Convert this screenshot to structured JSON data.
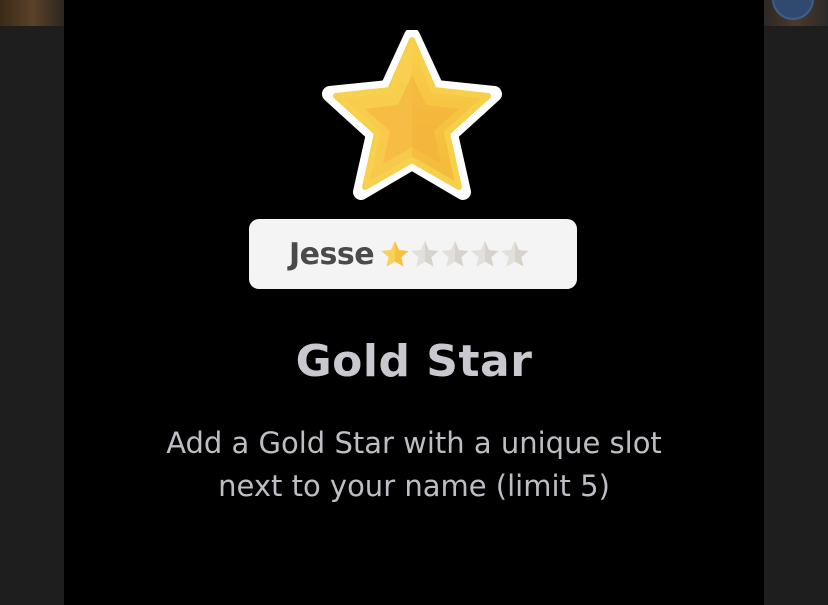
{
  "modal": {
    "title": "Gold Star",
    "description": "Add a Gold Star with a unique slot next to your name (limit 5)",
    "hero_icon": "gold-star-icon"
  },
  "badge": {
    "name": "Jesse",
    "stars_filled": 1,
    "stars_total": 5
  },
  "colors": {
    "gold": "#f6c13b",
    "gold_dark": "#f0a830",
    "star_empty": "#d8d6cf",
    "modal_bg": "#000000",
    "title_text": "#c8c8ce"
  }
}
